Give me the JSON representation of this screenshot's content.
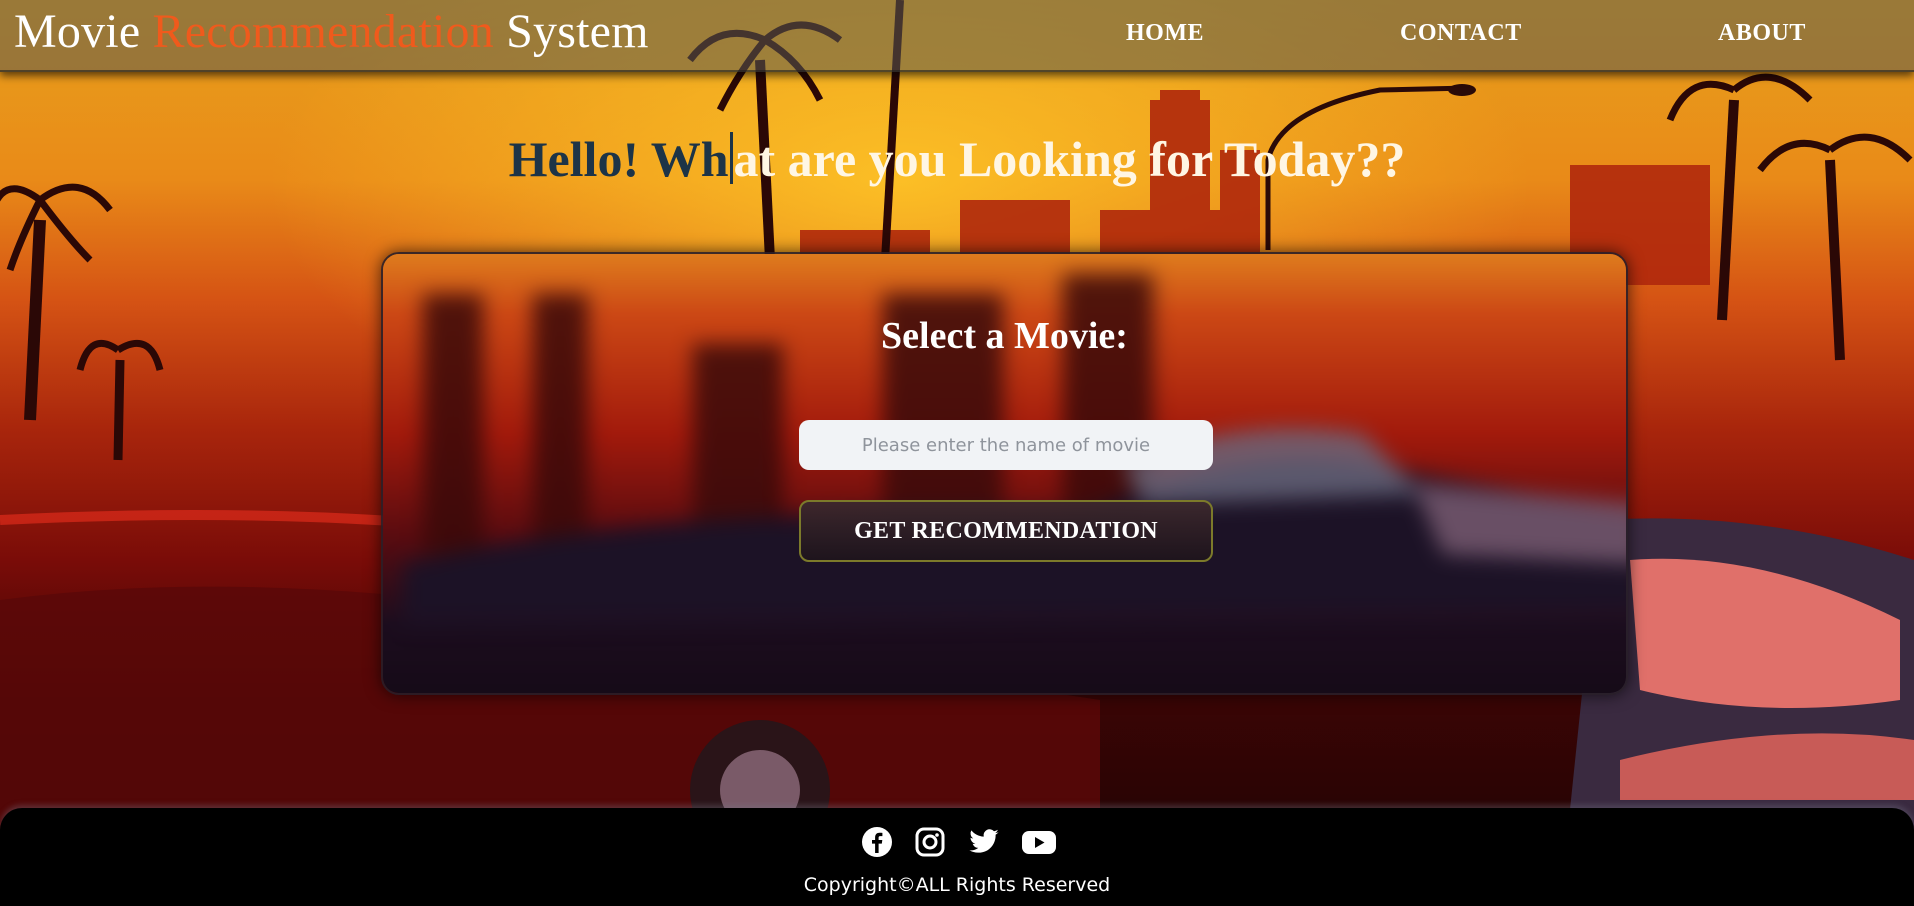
{
  "header": {
    "brand": {
      "part1": "Movie ",
      "part2": "Recommendation",
      "part3": " System"
    },
    "nav": [
      {
        "label": "HOME"
      },
      {
        "label": "CONTACT"
      },
      {
        "label": "ABOUT"
      }
    ]
  },
  "greeting": {
    "typed_dark": "Hello! Wh",
    "typed_light": "at are you Looking for Today??"
  },
  "card": {
    "title": "Select a Movie:",
    "input": {
      "value": "",
      "placeholder": "Please enter the name of movie"
    },
    "button_label": "GET RECOMMENDATION"
  },
  "footer": {
    "social_icons": [
      "facebook-icon",
      "instagram-icon",
      "twitter-icon",
      "youtube-icon"
    ],
    "copyright": "Copyright©ALL Rights Reserved"
  },
  "colors": {
    "brand_accent": "#f05a1c",
    "greeting_dark": "#1d3447",
    "footer_bg": "#000000",
    "button_border": "#7c7a2a"
  }
}
